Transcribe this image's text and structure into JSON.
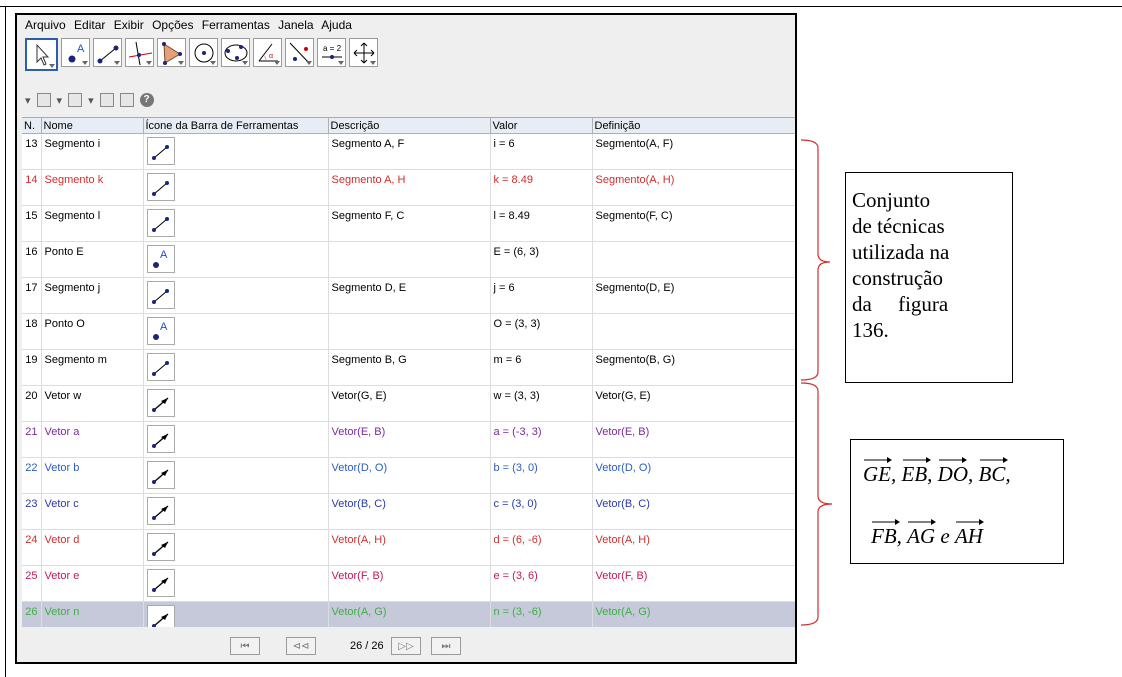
{
  "menu": [
    "Arquivo",
    "Editar",
    "Exibir",
    "Opções",
    "Ferramentas",
    "Janela",
    "Ajuda"
  ],
  "tools": [
    "move-tool-icon",
    "point-tool-icon",
    "segment-tool-icon",
    "perpendicular-tool-icon",
    "polygon-tool-icon",
    "circle-tool-icon",
    "conic-tool-icon",
    "angle-tool-icon",
    "reflect-tool-icon",
    "slider-tool-icon",
    "move-view-tool-icon"
  ],
  "slider_label": "a = 2",
  "help_icon": "?",
  "columns": [
    "N.",
    "Nome",
    "Ícone da Barra de Ferramentas",
    "Descrição",
    "Valor",
    "Definição"
  ],
  "rows": [
    {
      "n": "13",
      "name": "Segmento i",
      "icon": "segment",
      "desc": "Segmento A, F",
      "value": "i = 6",
      "def": "Segmento(A, F)",
      "color": "#000000"
    },
    {
      "n": "14",
      "name": "Segmento k",
      "icon": "segment",
      "desc": "Segmento A, H",
      "value": "k = 8.49",
      "def": "Segmento(A, H)",
      "color": "#d22d2d"
    },
    {
      "n": "15",
      "name": "Segmento l",
      "icon": "segment",
      "desc": "Segmento F, C",
      "value": "l = 8.49",
      "def": "Segmento(F, C)",
      "color": "#000000"
    },
    {
      "n": "16",
      "name": "Ponto E",
      "icon": "point",
      "desc": "",
      "value": "E = (6, 3)",
      "def": "",
      "color": "#000000"
    },
    {
      "n": "17",
      "name": "Segmento j",
      "icon": "segment",
      "desc": "Segmento D, E",
      "value": "j = 6",
      "def": "Segmento(D, E)",
      "color": "#000000"
    },
    {
      "n": "18",
      "name": "Ponto O",
      "icon": "point",
      "desc": "",
      "value": "O = (3, 3)",
      "def": "",
      "color": "#000000"
    },
    {
      "n": "19",
      "name": "Segmento m",
      "icon": "segment",
      "desc": "Segmento B, G",
      "value": "m = 6",
      "def": "Segmento(B, G)",
      "color": "#000000"
    },
    {
      "n": "20",
      "name": "Vetor w",
      "icon": "vector",
      "desc": "Vetor(G, E)",
      "value": "w = (3, 3)",
      "def": "Vetor(G, E)",
      "color": "#000000"
    },
    {
      "n": "21",
      "name": "Vetor a",
      "icon": "vector",
      "desc": "Vetor(E, B)",
      "value": "a = (-3, 3)",
      "def": "Vetor(E, B)",
      "color": "#7a2a9c"
    },
    {
      "n": "22",
      "name": "Vetor b",
      "icon": "vector",
      "desc": "Vetor(D, O)",
      "value": "b = (3, 0)",
      "def": "Vetor(D, O)",
      "color": "#2a5cc4"
    },
    {
      "n": "23",
      "name": "Vetor c",
      "icon": "vector",
      "desc": "Vetor(B, C)",
      "value": "c = (3, 0)",
      "def": "Vetor(B, C)",
      "color": "#2a3aa8"
    },
    {
      "n": "24",
      "name": "Vetor d",
      "icon": "vector",
      "desc": "Vetor(A, H)",
      "value": "d = (6, -6)",
      "def": "Vetor(A, H)",
      "color": "#d22d2d"
    },
    {
      "n": "25",
      "name": "Vetor e",
      "icon": "vector",
      "desc": "Vetor(F, B)",
      "value": "e = (3, 6)",
      "def": "Vetor(F, B)",
      "color": "#c2185b"
    },
    {
      "n": "26",
      "name": "Vetor n",
      "icon": "vector",
      "desc": "Vetor(A, G)",
      "value": "n = (3, -6)",
      "def": "Vetor(A, G)",
      "color": "#3cb043",
      "highlight": true
    }
  ],
  "nav": {
    "first": "⏮",
    "prev": "⊲⊲",
    "page": "26 / 26",
    "next": "▷▷",
    "last": "⏭"
  },
  "annotation1": {
    "lines": [
      "Conjunto",
      "de técnicas",
      "utilizada na",
      "construção",
      "da     figura",
      "136."
    ]
  },
  "annotation2": {
    "line1": [
      "GE",
      "EB",
      "DO",
      "BC"
    ],
    "line2": [
      "FB",
      "AG",
      "AH"
    ],
    "separator": ",",
    "conj": "e"
  },
  "bracket_color": "#d22d2d"
}
